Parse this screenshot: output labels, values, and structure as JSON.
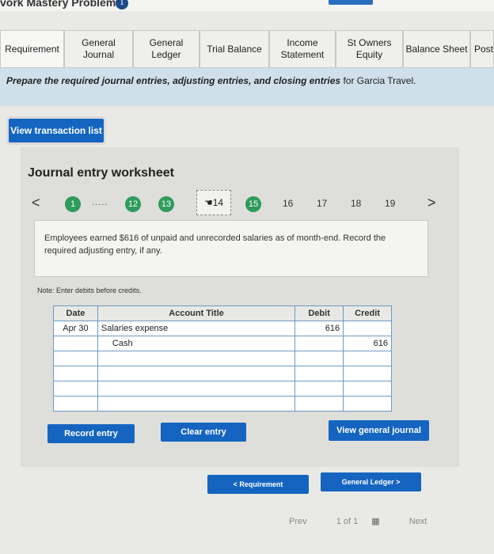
{
  "header": {
    "title": "vork Mastery Problem",
    "badge": "1"
  },
  "tabs": [
    {
      "label": "Requirement"
    },
    {
      "label": "General Journal"
    },
    {
      "label": "General Ledger"
    },
    {
      "label": "Trial Balance"
    },
    {
      "label": "Income Statement"
    },
    {
      "label": "St Owners Equity"
    },
    {
      "label": "Balance Sheet"
    },
    {
      "label": "Post"
    }
  ],
  "banner": {
    "bold_text": "Prepare the required journal entries, adjusting entries, and closing entries",
    "rest_text": " for Garcia Travel."
  },
  "view_transaction_list": "View transaction list",
  "worksheet": {
    "title": "Journal entry worksheet",
    "pager": {
      "prev": "<",
      "next": ">",
      "first": "1",
      "ellipsis": ".....",
      "p12": "12",
      "p13": "13",
      "current": "14",
      "p15": "15",
      "p16": "16",
      "p17": "17",
      "p18": "18",
      "p19": "19"
    },
    "description": "Employees earned $616 of unpaid and unrecorded salaries as of month-end. Record the required adjusting entry, if any.",
    "note": "Note: Enter debits before credits.",
    "table": {
      "headers": {
        "date": "Date",
        "account": "Account Title",
        "debit": "Debit",
        "credit": "Credit"
      },
      "rows": [
        {
          "date": "Apr 30",
          "account": "Salaries expense",
          "debit": "616",
          "credit": ""
        },
        {
          "date": "",
          "account": "Cash",
          "debit": "",
          "credit": "616"
        },
        {
          "date": "",
          "account": "",
          "debit": "",
          "credit": ""
        },
        {
          "date": "",
          "account": "",
          "debit": "",
          "credit": ""
        },
        {
          "date": "",
          "account": "",
          "debit": "",
          "credit": ""
        },
        {
          "date": "",
          "account": "",
          "debit": "",
          "credit": ""
        }
      ]
    },
    "record_entry": "Record entry",
    "clear_entry": "Clear entry",
    "view_general_journal": "View general journal"
  },
  "nav": {
    "requirement": "< Requirement",
    "general_ledger": "General Ledger >"
  },
  "footer": {
    "prev": "Prev",
    "page": "1 of 1",
    "next": "Next"
  }
}
